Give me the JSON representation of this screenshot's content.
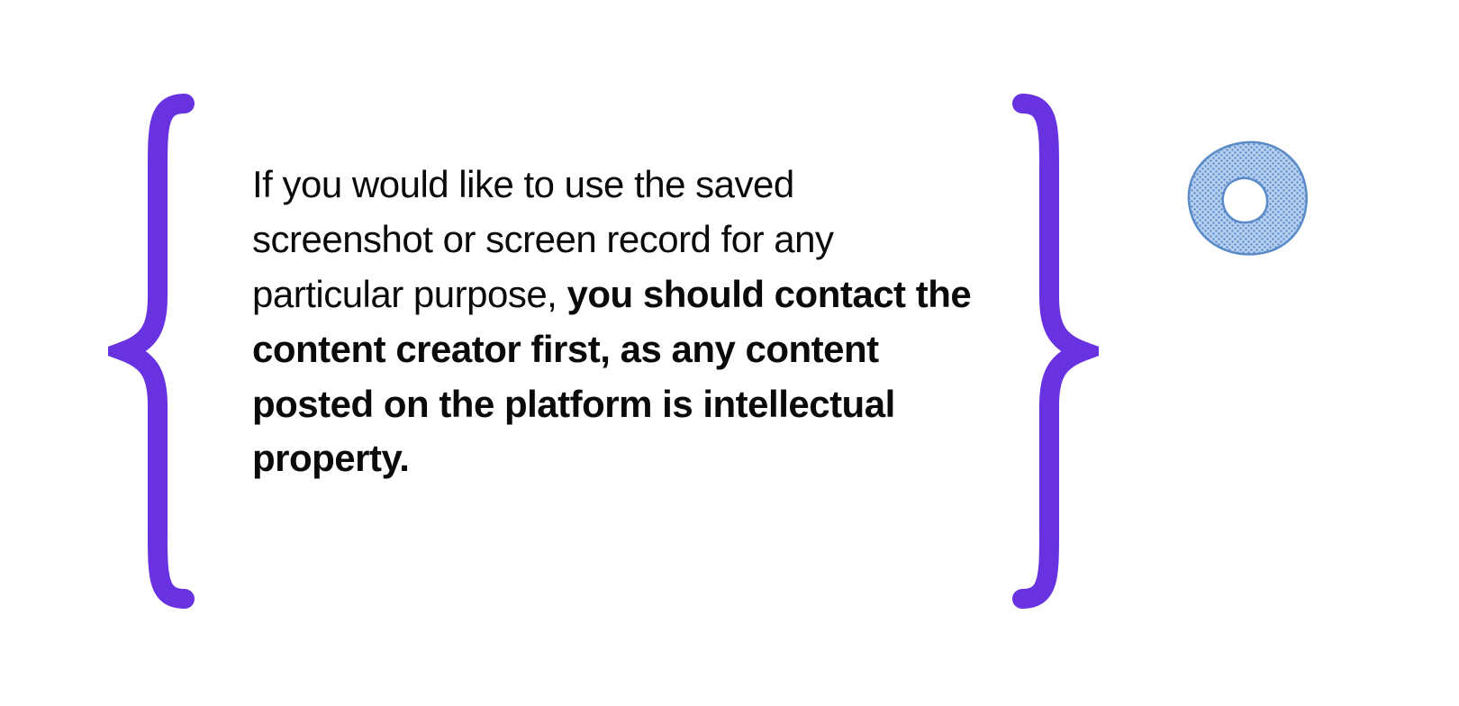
{
  "quote": {
    "text_normal": "If you would like to use the saved screenshot or screen record for any particular purpose, ",
    "text_bold": "you should contact the content creator first, as any content posted on the platform is intellectual property."
  },
  "colors": {
    "brace": "#6932E0",
    "donut_fill": "#9BBBE8",
    "donut_stroke": "#5A8BC9",
    "text": "#0a0a0a"
  }
}
